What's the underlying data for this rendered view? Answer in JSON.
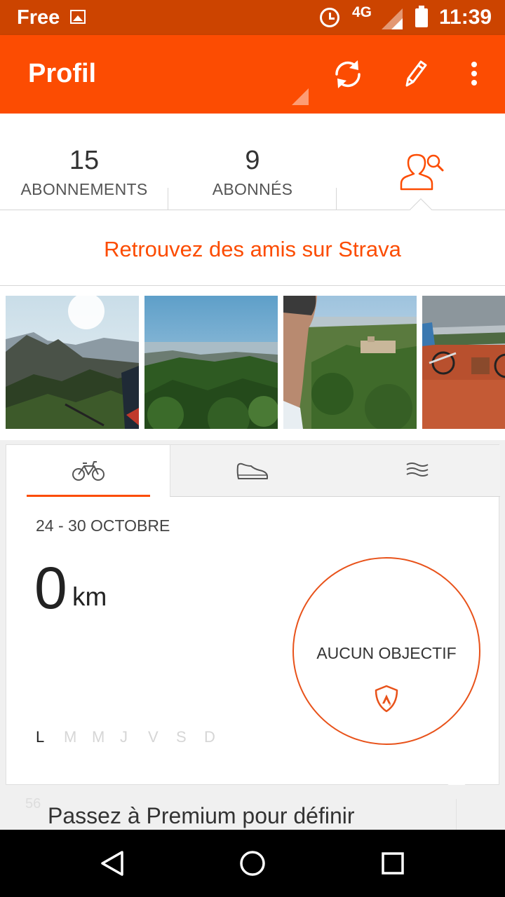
{
  "status_bar": {
    "carrier": "Free",
    "network": "4G",
    "time": "11:39",
    "icons": [
      "image-icon",
      "alarm-icon",
      "signal-icon",
      "battery-icon"
    ]
  },
  "app_bar": {
    "title": "Profil",
    "actions": [
      "refresh-icon",
      "edit-icon",
      "more-vert-icon"
    ],
    "color": "#fc4c02"
  },
  "stats": {
    "following": {
      "count": "15",
      "label": "ABONNEMENTS"
    },
    "followers": {
      "count": "9",
      "label": "ABONNÉS"
    },
    "find_icon": "find-friends-icon"
  },
  "find_friends": {
    "label": "Retrouvez des amis sur Strava"
  },
  "photos": [
    {
      "icon": "mountain-landscape-photo"
    },
    {
      "icon": "forest-view-photo"
    },
    {
      "icon": "selfie-village-photo"
    },
    {
      "icon": "cyclists-red-dirt-photo"
    }
  ],
  "activity_tabs": [
    {
      "icon": "bike-icon",
      "selected": true
    },
    {
      "icon": "shoe-icon",
      "selected": false
    },
    {
      "icon": "swim-icon",
      "selected": false
    }
  ],
  "weekly": {
    "date_range": "24 - 30 OCTOBRE",
    "distance": "0",
    "unit": "km",
    "days": [
      "L",
      "M",
      "M",
      "J",
      "V",
      "S",
      "D"
    ],
    "active_day_index": 0
  },
  "goal": {
    "label": "AUCUN OBJECTIF",
    "badge_icon": "strava-shield-icon"
  },
  "premium": {
    "background_number": "56",
    "text": "Passez à Premium pour définir"
  },
  "nav_bar": {
    "buttons": [
      "back-icon",
      "home-icon",
      "recents-icon"
    ]
  }
}
